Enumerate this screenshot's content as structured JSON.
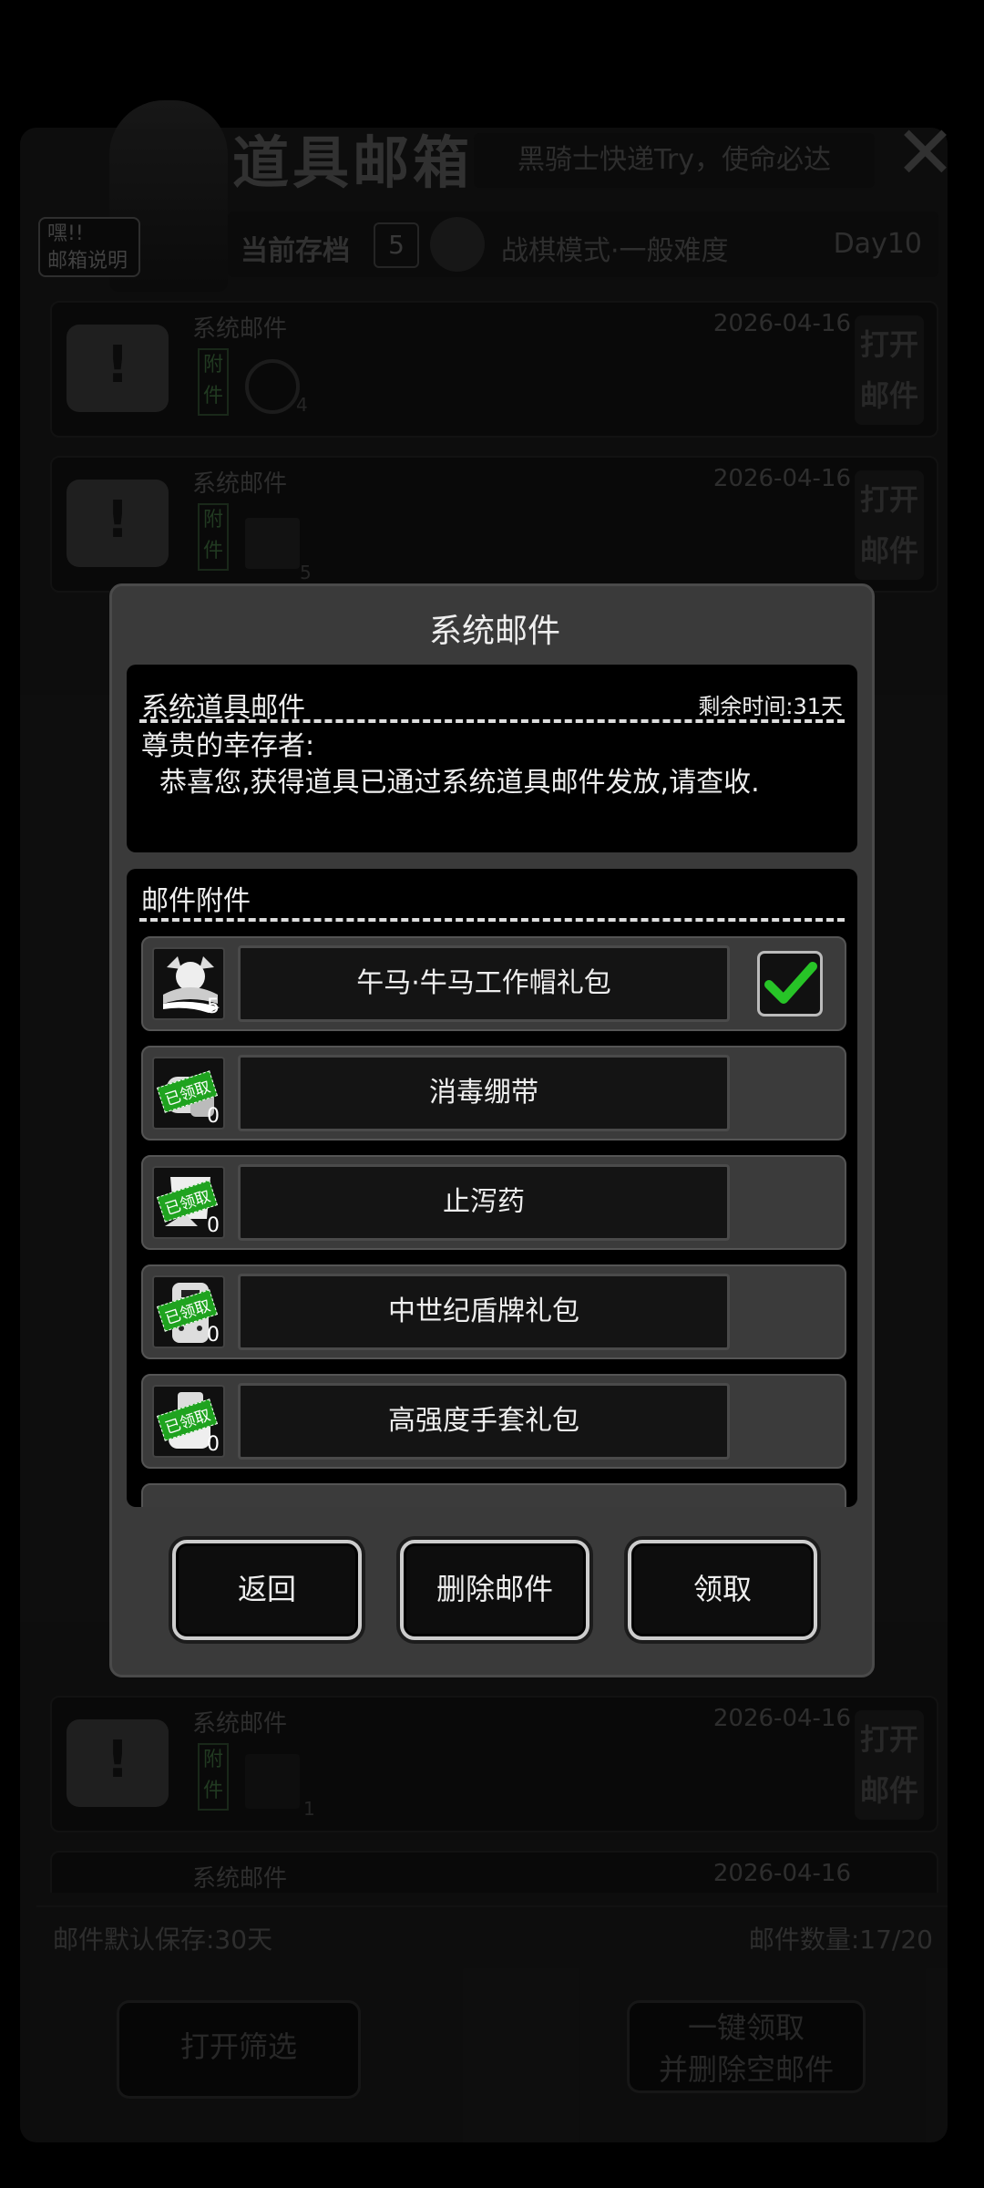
{
  "background": {
    "title": "道具邮箱",
    "slogan": "黑骑士快递Try，使命必达",
    "help_label": "嘿!!\n邮箱说明",
    "save_label": "当前存档",
    "save_number": "5",
    "mode": "战棋模式·一般难度",
    "day": "Day10",
    "mails": [
      {
        "name": "系统邮件",
        "date": "2026-04-16",
        "attach_label": "附件",
        "open_label": "打开\n邮件",
        "extra": "4"
      },
      {
        "name": "系统邮件",
        "date": "2026-04-16",
        "attach_label": "附件",
        "open_label": "打开\n邮件",
        "extra": "5"
      },
      {
        "name": "系统邮件",
        "date": "2026-04-16",
        "attach_label": "附件",
        "open_label": "打开\n邮件",
        "extra": "1"
      },
      {
        "name": "系统邮件",
        "date": "2026-04-16"
      }
    ],
    "footer_left": "邮件默认保存:30天",
    "footer_right": "邮件数量:17/20",
    "filter_button": "打开筛选",
    "claim_all_button": "一键领取\n并删除空邮件"
  },
  "modal": {
    "title": "系统邮件",
    "content": {
      "heading": "系统道具邮件",
      "remaining": "剩余时间:31天",
      "greeting": "尊贵的幸存者:",
      "body": "恭喜您,获得道具已通过系统道具邮件发放,请查收."
    },
    "attachments": {
      "heading": "邮件附件",
      "stamp_text": "已领取",
      "items": [
        {
          "name": "午马·牛马工作帽礼包",
          "qty": "5",
          "checked": true,
          "claimed": false
        },
        {
          "name": "消毒绷带",
          "qty": "0",
          "checked": false,
          "claimed": true
        },
        {
          "name": "止泻药",
          "qty": "0",
          "checked": false,
          "claimed": true
        },
        {
          "name": "中世纪盾牌礼包",
          "qty": "0",
          "checked": false,
          "claimed": true
        },
        {
          "name": "高强度手套礼包",
          "qty": "0",
          "checked": false,
          "claimed": true
        }
      ]
    },
    "buttons": {
      "back": "返回",
      "delete": "删除邮件",
      "claim": "领取"
    }
  },
  "colors": {
    "accent_green": "#1fa31f",
    "overlay": "#000000"
  }
}
